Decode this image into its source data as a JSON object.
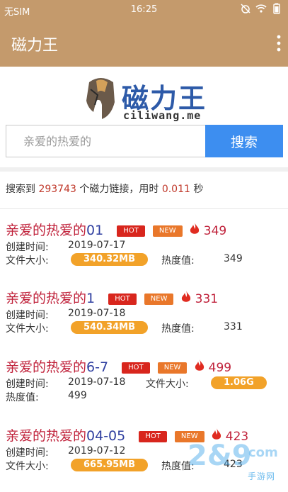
{
  "status_bar": {
    "carrier": "无SIM",
    "time": "16:25",
    "icons": [
      "alarm-off-icon",
      "wifi-icon",
      "battery-icon"
    ]
  },
  "app_bar": {
    "title": "磁力王",
    "menu_icon": "more-vert-icon"
  },
  "logo": {
    "name": "磁力王",
    "domain": "ciliwang.me"
  },
  "search": {
    "value": "",
    "placeholder": "亲爱的热爱的",
    "button_label": "搜索"
  },
  "summary": {
    "prefix": "搜索到",
    "count": "293743",
    "middle": "个磁力链接，用时",
    "time": "0.011",
    "unit": "秒"
  },
  "labels": {
    "created": "创建时间:",
    "size": "文件大小:",
    "heat": "热度值:",
    "hot_tag": "HOT",
    "new_tag": "NEW"
  },
  "results": [
    {
      "title": "亲爱的热爱的",
      "suffix": "01",
      "heat": "349",
      "created": "2019-07-17",
      "size": "340.32MB"
    },
    {
      "title": "亲爱的热爱的",
      "suffix": "1",
      "heat": "331",
      "created": "2019-07-18",
      "size": "540.34MB"
    },
    {
      "title": "亲爱的热爱的",
      "suffix": "6-7",
      "heat": "499",
      "created": "2019-07-18",
      "size": "1.06G"
    },
    {
      "title": "亲爱的热爱的",
      "suffix": "04-05",
      "heat": "423",
      "created": "2019-07-12",
      "size": "665.95MB"
    }
  ],
  "watermark": {
    "logo": "2&9",
    "text": "手游网",
    "domain": "com"
  },
  "colors": {
    "appbar": "#c49a6c",
    "search_button": "#3d8ef0",
    "title_red": "#c0223b",
    "title_blue": "#2f3fa0",
    "hot": "#d8261d",
    "new": "#e9772a",
    "size_pill": "#f2a229"
  }
}
